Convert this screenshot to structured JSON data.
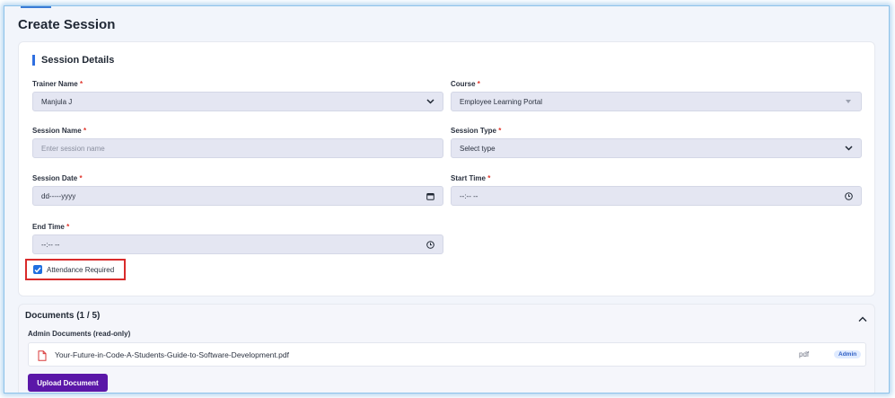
{
  "page": {
    "title": "Create Session"
  },
  "session_details": {
    "section_title": "Session Details",
    "trainer": {
      "label": "Trainer Name",
      "required": "*",
      "value": "Manjula J"
    },
    "course": {
      "label": "Course",
      "required": "*",
      "value": "Employee Learning Portal"
    },
    "session_name": {
      "label": "Session Name",
      "required": "*",
      "placeholder": "Enter session name"
    },
    "session_type": {
      "label": "Session Type",
      "required": "*",
      "value": "Select type"
    },
    "session_date": {
      "label": "Session Date",
      "required": "*",
      "value": "dd-----yyyy"
    },
    "start_time": {
      "label": "Start Time",
      "required": "*",
      "value": "--:-- --"
    },
    "end_time": {
      "label": "End Time",
      "required": "*",
      "value": "--:-- --"
    },
    "attendance": {
      "label": "Attendance Required",
      "checked": true
    }
  },
  "documents": {
    "title": "Documents (1 / 5)",
    "admin_label": "Admin Documents (read-only)",
    "items": [
      {
        "name": "Your-Future-in-Code-A-Students-Guide-to-Software-Development.pdf",
        "type": "pdf",
        "badge": "Admin"
      }
    ],
    "upload_label": "Upload Document"
  },
  "colors": {
    "accent": "#2f6fe0",
    "upload_button": "#5b17a8",
    "highlight_border": "#d92b2b"
  }
}
